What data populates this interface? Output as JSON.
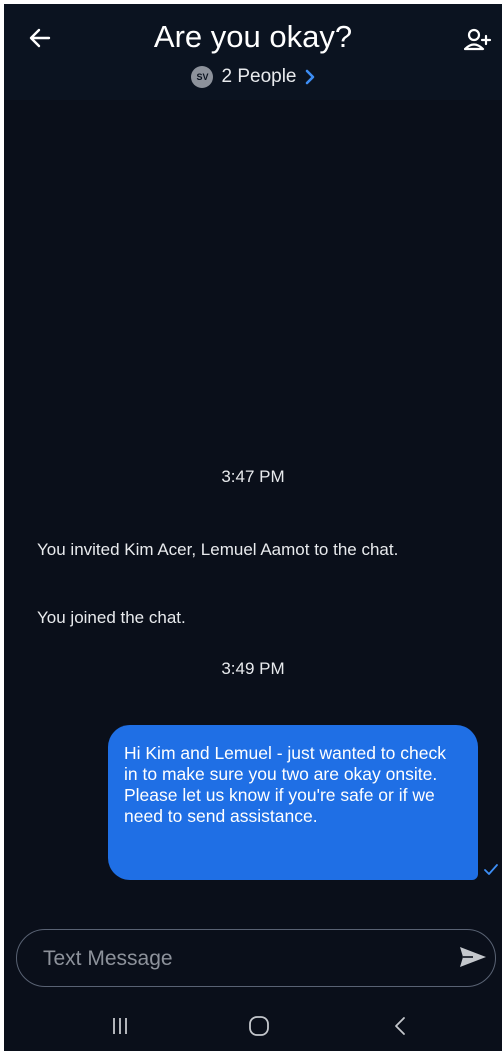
{
  "header": {
    "title": "Are you okay?",
    "avatar_initials": "SV",
    "people_label": "2 People",
    "back_icon": "arrow-left-icon",
    "add_icon": "add-person-icon"
  },
  "messages": {
    "timestamp_1": "3:47 PM",
    "system_line_1": "You invited Kim Acer, Lemuel Aamot to the chat.",
    "system_line_2": "You joined the chat.",
    "timestamp_2": "3:49 PM",
    "outgoing_text": "Hi Kim and Lemuel - just wanted to check in to make sure you two are okay onsite. Please let us know if you're safe or if we need to send assistance.",
    "outgoing_status_icon": "check-icon"
  },
  "composer": {
    "placeholder": "Text Message",
    "send_icon": "send-icon"
  },
  "navbar": {
    "recents_icon": "recents-icon",
    "home_icon": "home-icon",
    "back_icon": "back-chevron-icon"
  },
  "colors": {
    "background": "#0a0f1a",
    "header": "#0b1320",
    "accent": "#1f6fe5",
    "text": "#e8eaed"
  }
}
